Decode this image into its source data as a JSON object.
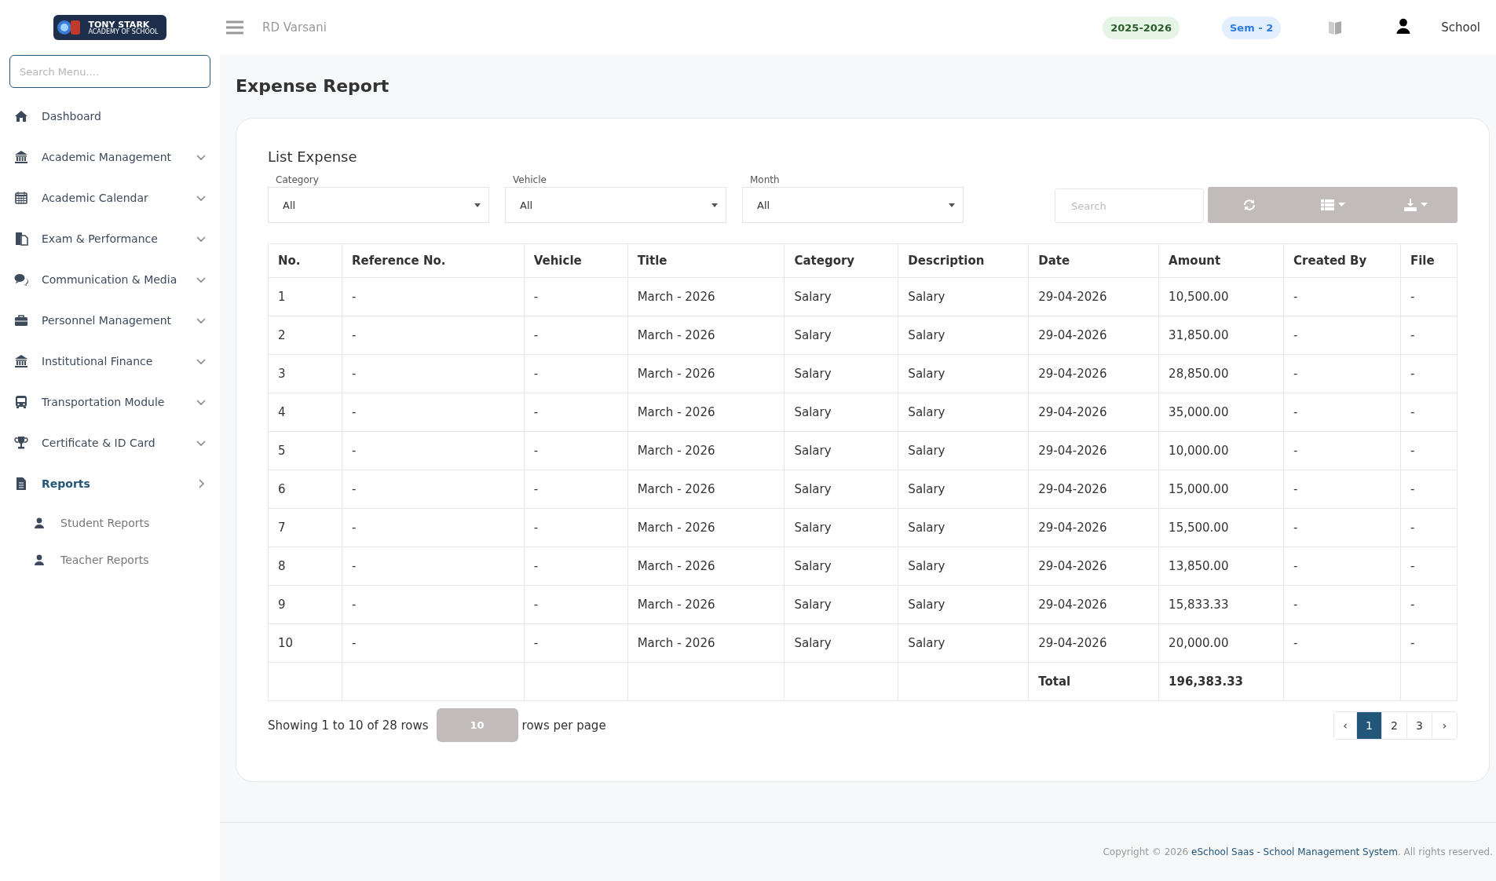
{
  "logo": {
    "title": "TONY STARK",
    "subtitle": "ACADEMY OF SCHOOL"
  },
  "header": {
    "school": "RD Varsani",
    "session": "2025-2026",
    "semester": "Sem - 2",
    "user": "School"
  },
  "sidebar": {
    "search": {
      "placeholder": "Search Menu...."
    },
    "items": [
      {
        "label": "Dashboard",
        "kind": "link",
        "selected": false
      },
      {
        "label": "Academic Management",
        "kind": "group",
        "selected": false
      },
      {
        "label": "Academic Calendar",
        "kind": "group",
        "selected": false
      },
      {
        "label": "Exam & Performance",
        "kind": "group",
        "selected": false
      },
      {
        "label": "Communication & Media",
        "kind": "group",
        "selected": false
      },
      {
        "label": "Personnel Management",
        "kind": "group",
        "selected": false
      },
      {
        "label": "Institutional Finance",
        "kind": "group",
        "selected": false
      },
      {
        "label": "Transportation Module",
        "kind": "group",
        "selected": false
      },
      {
        "label": "Certificate & ID Card",
        "kind": "group",
        "selected": false
      },
      {
        "label": "Reports",
        "kind": "group",
        "selected": true,
        "children": [
          {
            "label": "Student Reports"
          },
          {
            "label": "Teacher Reports"
          }
        ]
      }
    ]
  },
  "page_title": "Expense Report",
  "card": {
    "title": "List Expense",
    "filters": [
      {
        "label": "Category",
        "value": "All"
      },
      {
        "label": "Vehicle",
        "value": "All"
      },
      {
        "label": "Month",
        "value": "All"
      }
    ],
    "search": {
      "placeholder": "Search"
    },
    "table": {
      "columns": [
        "No.",
        "Reference No.",
        "Vehicle",
        "Title",
        "Category",
        "Description",
        "Date",
        "Amount",
        "Created By",
        "File"
      ],
      "rows": [
        [
          "1",
          "-",
          "-",
          "March - 2026",
          "Salary",
          "Salary",
          "29-04-2026",
          "10,500.00",
          "-",
          "-"
        ],
        [
          "2",
          "-",
          "-",
          "March - 2026",
          "Salary",
          "Salary",
          "29-04-2026",
          "31,850.00",
          "-",
          "-"
        ],
        [
          "3",
          "-",
          "-",
          "March - 2026",
          "Salary",
          "Salary",
          "29-04-2026",
          "28,850.00",
          "-",
          "-"
        ],
        [
          "4",
          "-",
          "-",
          "March - 2026",
          "Salary",
          "Salary",
          "29-04-2026",
          "35,000.00",
          "-",
          "-"
        ],
        [
          "5",
          "-",
          "-",
          "March - 2026",
          "Salary",
          "Salary",
          "29-04-2026",
          "10,000.00",
          "-",
          "-"
        ],
        [
          "6",
          "-",
          "-",
          "March - 2026",
          "Salary",
          "Salary",
          "29-04-2026",
          "15,000.00",
          "-",
          "-"
        ],
        [
          "7",
          "-",
          "-",
          "March - 2026",
          "Salary",
          "Salary",
          "29-04-2026",
          "15,500.00",
          "-",
          "-"
        ],
        [
          "8",
          "-",
          "-",
          "March - 2026",
          "Salary",
          "Salary",
          "29-04-2026",
          "13,850.00",
          "-",
          "-"
        ],
        [
          "9",
          "-",
          "-",
          "March - 2026",
          "Salary",
          "Salary",
          "29-04-2026",
          "15,833.33",
          "-",
          "-"
        ],
        [
          "10",
          "-",
          "-",
          "March - 2026",
          "Salary",
          "Salary",
          "29-04-2026",
          "20,000.00",
          "-",
          "-"
        ]
      ],
      "total": {
        "label": "Total",
        "amount": "196,383.33"
      }
    },
    "pagination": {
      "summary": "Showing 1 to 10 of 28 rows",
      "page_size": "10",
      "suffix": "rows per page",
      "prev": "‹",
      "next": "›",
      "pages": [
        {
          "label": "1",
          "selected": true
        },
        {
          "label": "2",
          "selected": false
        },
        {
          "label": "3",
          "selected": false
        }
      ]
    }
  },
  "footer": {
    "prefix": "Copyright © 2026 ",
    "link": "eSchool Saas - School Management System",
    "suffix": ". All rights reserved."
  }
}
